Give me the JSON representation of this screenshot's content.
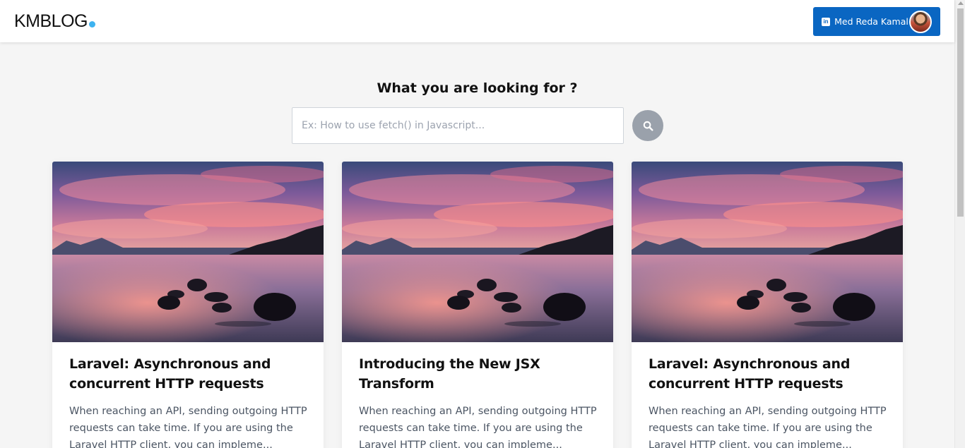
{
  "header": {
    "logo_text": "KMBLOG",
    "logo_dot_color": "#3eb3f0",
    "profile_button": {
      "label": "Med Reda Kamal",
      "icon": "linkedin-icon",
      "background": "#0a66c2"
    }
  },
  "search": {
    "title": "What you are looking for ?",
    "placeholder": "Ex: How to use fetch() in Javascript...",
    "value": "",
    "button_icon": "search-icon"
  },
  "posts": [
    {
      "title": "Laravel: Asynchronous and concurrent HTTP requests",
      "excerpt": "When reaching an API, sending outgoing HTTP requests can take time. If you are using the Laravel HTTP client, you can impleme..."
    },
    {
      "title": "Introducing the New JSX Transform",
      "excerpt": "When reaching an API, sending outgoing HTTP requests can take time. If you are using the Laravel HTTP client, you can impleme..."
    },
    {
      "title": "Laravel: Asynchronous and concurrent HTTP requests",
      "excerpt": "When reaching an API, sending outgoing HTTP requests can take time. If you are using the Laravel HTTP client, you can impleme..."
    }
  ]
}
